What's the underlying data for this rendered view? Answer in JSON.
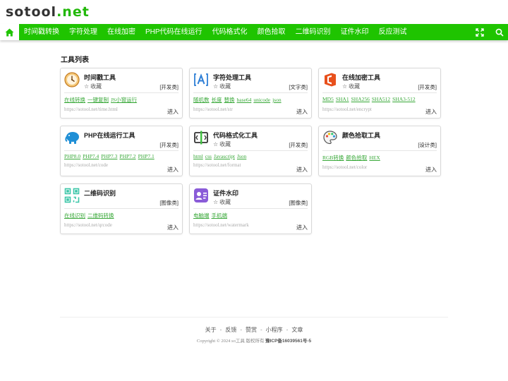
{
  "header": {
    "logo_main": "sotool",
    "logo_dot": ".",
    "logo_tld": "net"
  },
  "nav": {
    "items": [
      "时间戳转换",
      "字符处理",
      "在线加密",
      "PHP代码在线运行",
      "代码格式化",
      "颜色拾取",
      "二维码识别",
      "证件水印",
      "反应测试"
    ],
    "icons": [
      "home-icon",
      "fullscreen-icon",
      "search-icon"
    ],
    "colors": {
      "bar": "#1fc400",
      "accent": "#22b80a",
      "link": "#38a838"
    }
  },
  "section_title": "工具列表",
  "fav_label": "收藏",
  "enter_label": "进入",
  "tools": [
    {
      "name": "时间戳工具",
      "category": "[开发类]",
      "links": [
        "在线转换",
        "一键复制",
        "JS小窗运行"
      ],
      "url": "https://sotool.net/time.html",
      "icon": "clock-icon"
    },
    {
      "name": "字符处理工具",
      "category": "[文字类]",
      "links": [
        "随机数",
        "长度",
        "替换",
        "base64",
        "unicode",
        "json"
      ],
      "url": "https://sotool.net/str",
      "icon": "text-a-icon"
    },
    {
      "name": "在线加密工具",
      "category": "[开发类]",
      "links": [
        "MD5",
        "SHA1",
        "SHA256",
        "SHA512",
        "SHA3-512"
      ],
      "url": "https://sotool.net/encrypt",
      "icon": "office-icon"
    },
    {
      "name": "PHP在线运行工具",
      "category": "[开发类]",
      "links": [
        "PHP8.0",
        "PHP7.4",
        "PHP7.3",
        "PHP7.2",
        "PHP7.1"
      ],
      "url": "https://sotool.net/code",
      "icon": "php-elephant-icon"
    },
    {
      "name": "代码格式化工具",
      "category": "[开发类]",
      "links": [
        "html",
        "css",
        "Javascript",
        "Json"
      ],
      "url": "https://sotool.net/format",
      "icon": "code-format-icon"
    },
    {
      "name": "颜色拾取工具",
      "category": "[设计类]",
      "links": [
        "RGB转换",
        "颜色拾取",
        "HEX"
      ],
      "url": "https://sotool.net/color",
      "icon": "palette-icon"
    },
    {
      "name": "二维码识别",
      "category": "[图像类]",
      "links": [
        "在线识别",
        "二维码转换"
      ],
      "url": "https://sotool.net/qrcode",
      "icon": "qrcode-icon"
    },
    {
      "name": "证件水印",
      "category": "[图像类]",
      "links": [
        "电脑端",
        "手机端"
      ],
      "url": "https://sotool.net/watermark",
      "icon": "id-card-icon"
    }
  ],
  "footer": {
    "links": [
      "关于",
      "反馈",
      "赞赏",
      "小程序",
      "文章"
    ],
    "separator": "-",
    "copyright": "Copyright © 2024 so工具 版权所有",
    "icp": "豫ICP备16039561号-5"
  }
}
